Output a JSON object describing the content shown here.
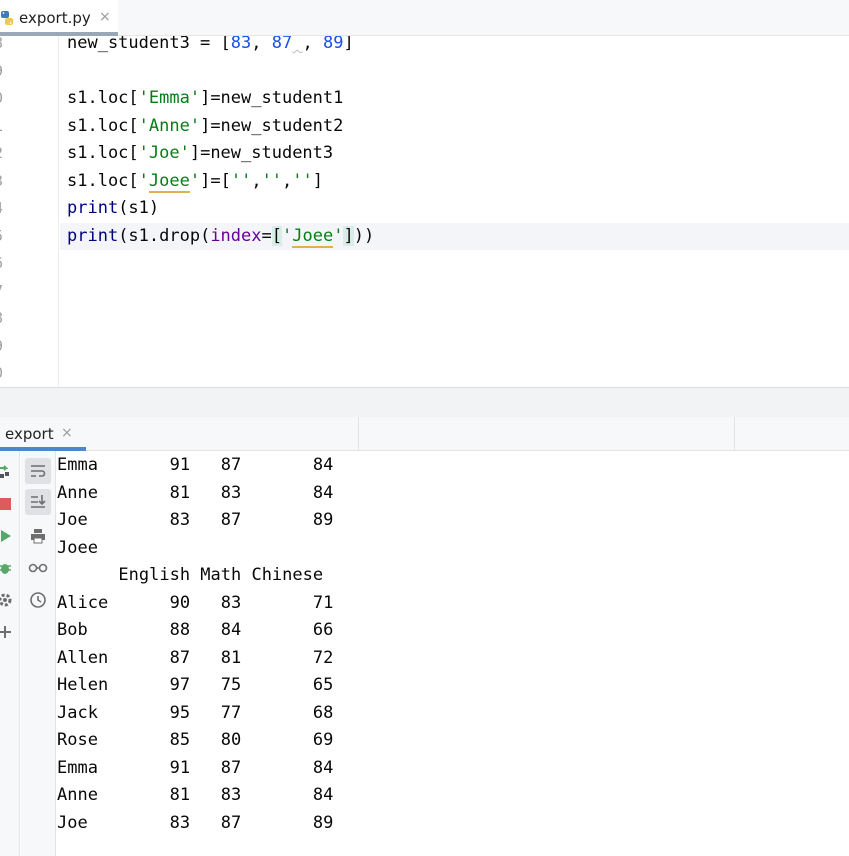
{
  "editor_tab": {
    "filename": "export.py",
    "close": "×"
  },
  "editor": {
    "line_numbers": [
      "8",
      "9",
      "0",
      "1",
      "2",
      "3",
      "4",
      "5",
      "6",
      "7",
      "8",
      "9",
      "0"
    ],
    "code": [
      {
        "parts": [
          {
            "t": "new_student3 = ["
          },
          {
            "t": "83",
            "c": "num"
          },
          {
            "t": ", "
          },
          {
            "t": "87",
            "c": "num"
          },
          {
            "t": " ",
            "c": "squig"
          },
          {
            "t": ", "
          },
          {
            "t": "89",
            "c": "num"
          },
          {
            "t": "]"
          }
        ]
      },
      {
        "parts": []
      },
      {
        "parts": [
          {
            "t": "s1.loc["
          },
          {
            "t": "'Emma'",
            "c": "str"
          },
          {
            "t": "]=new_student1"
          }
        ]
      },
      {
        "parts": [
          {
            "t": "s1.loc["
          },
          {
            "t": "'Anne'",
            "c": "str"
          },
          {
            "t": "]=new_student2"
          }
        ]
      },
      {
        "parts": [
          {
            "t": "s1.loc["
          },
          {
            "t": "'Joe'",
            "c": "str"
          },
          {
            "t": "]=new_student3"
          }
        ]
      },
      {
        "parts": [
          {
            "t": "s1.loc["
          },
          {
            "t": "'",
            "c": "str"
          },
          {
            "t": "Joee",
            "c": "str warn"
          },
          {
            "t": "'",
            "c": "str"
          },
          {
            "t": "]=["
          },
          {
            "t": "''",
            "c": "str"
          },
          {
            "t": ","
          },
          {
            "t": "''",
            "c": "str"
          },
          {
            "t": ","
          },
          {
            "t": "''",
            "c": "str"
          },
          {
            "t": "]"
          }
        ]
      },
      {
        "parts": [
          {
            "t": "print",
            "c": "kw"
          },
          {
            "t": "(s1)"
          }
        ]
      },
      {
        "parts": [
          {
            "t": "print",
            "c": "kw"
          },
          {
            "t": "(s1.drop("
          },
          {
            "t": "index",
            "c": "kwarg"
          },
          {
            "t": "="
          },
          {
            "t": "[",
            "c": "brk"
          },
          {
            "t": "'",
            "c": "str"
          },
          {
            "t": "Joee",
            "c": "str warn"
          },
          {
            "t": "'",
            "c": "str"
          },
          {
            "t": "]",
            "c": "brk"
          },
          {
            "t": "))"
          }
        ]
      },
      {
        "parts": []
      },
      {
        "parts": []
      },
      {
        "parts": []
      },
      {
        "parts": []
      },
      {
        "parts": []
      }
    ],
    "current_line": 7
  },
  "run_panel": {
    "tab_label": "export",
    "close": "×",
    "left_toolbar": [
      "rerun-icon",
      "stop-icon",
      "run-icon",
      "debug-icon",
      "settings-icon",
      "add-icon"
    ],
    "console_toolbar": [
      "soft-wrap-icon",
      "scroll-to-end-icon",
      "print-icon",
      "glasses-icon",
      "history-icon"
    ],
    "console_lines": [
      "Emma       91   87       84",
      "Anne       81   83       84",
      "Joe        83   87       89",
      "Joee",
      "      English Math Chinese",
      "Alice      90   83       71",
      "Bob        88   84       66",
      "Allen      87   81       72",
      "Helen      97   75       65",
      "Jack       95   77       68",
      "Rose       85   80       69",
      "Emma       91   87       84",
      "Anne       81   83       84",
      "Joe        83   87       89"
    ]
  }
}
